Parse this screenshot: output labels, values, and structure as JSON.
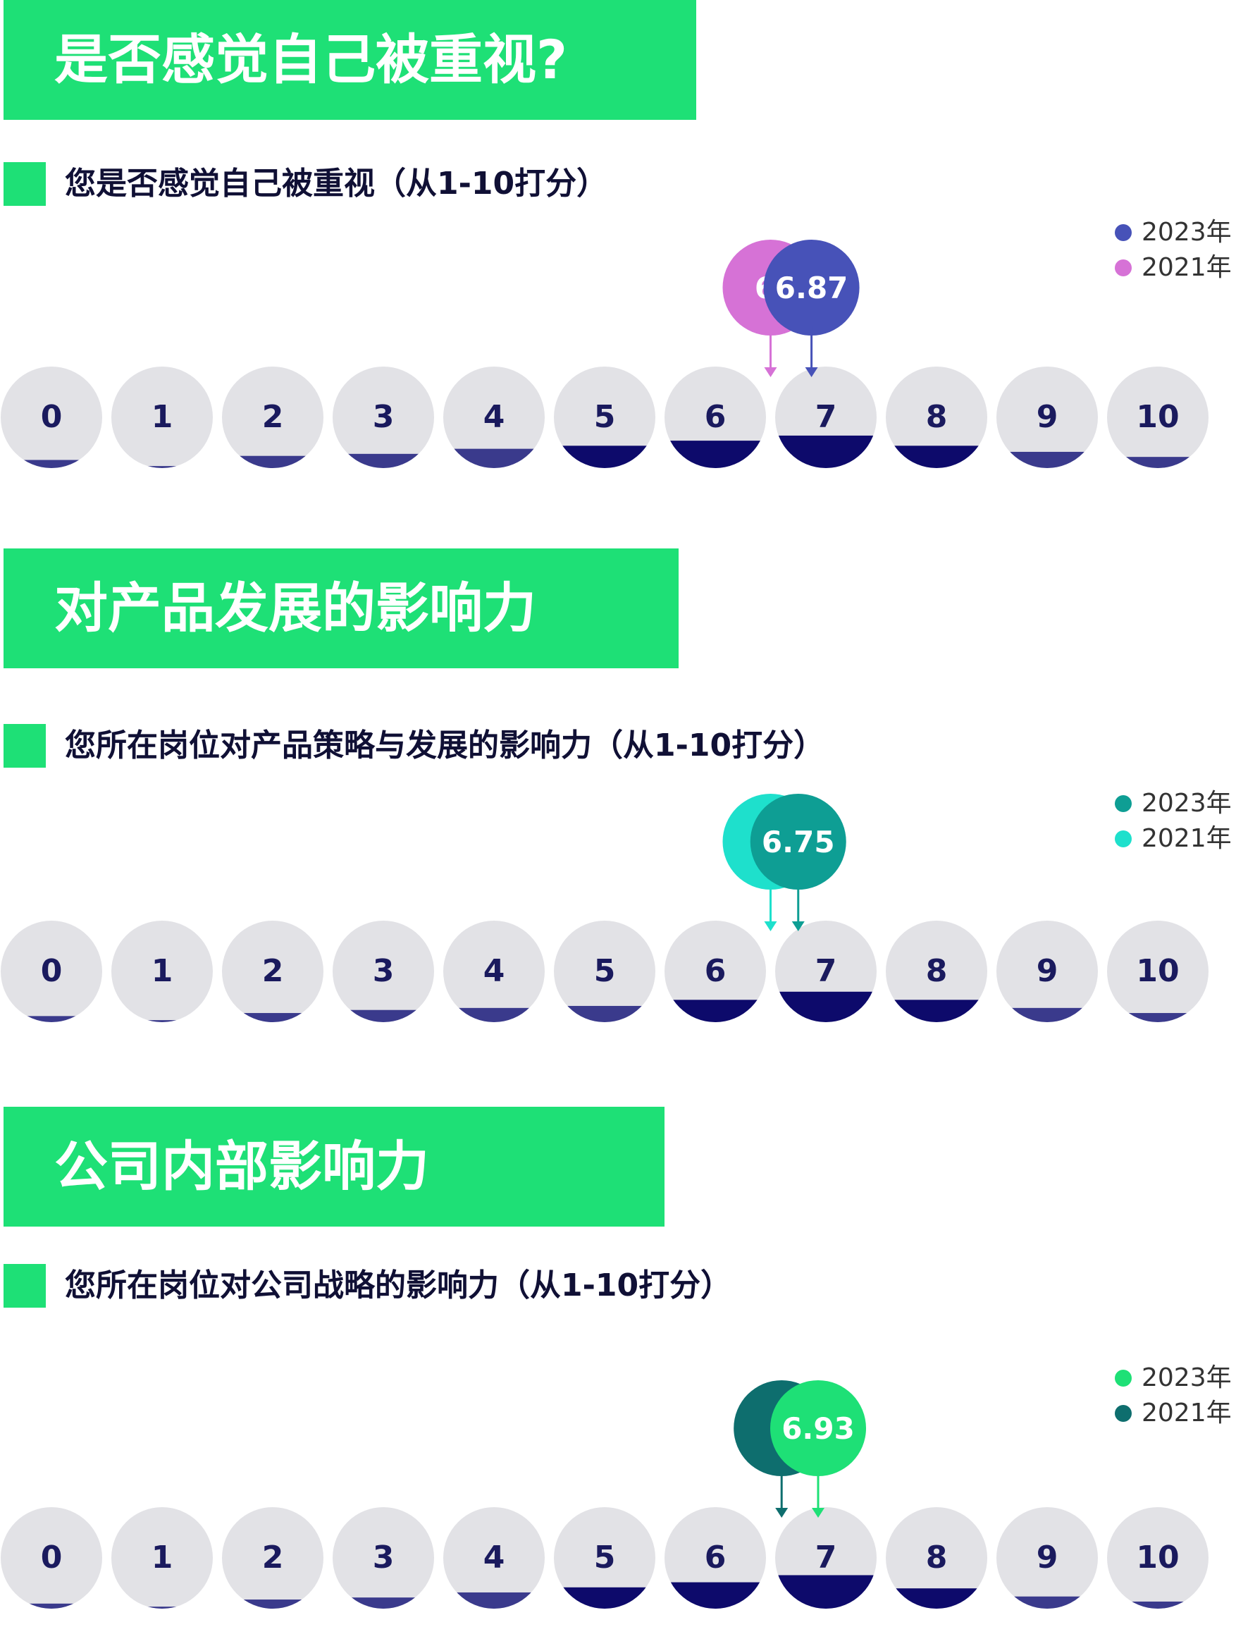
{
  "sections": [
    {
      "title": "是否感觉自己被重视?",
      "question": "您是否感觉自己被重视（从1-10打分）",
      "legend": [
        {
          "label": "2023年",
          "color": "#4752b8"
        },
        {
          "label": "2021年",
          "color": "#d672d6"
        }
      ]
    },
    {
      "title": "对产品发展的影响力",
      "question": "您所在岗位对产品策略与发展的影响力（从1-10打分）",
      "legend": [
        {
          "label": "2023年",
          "color": "#0e9e94"
        },
        {
          "label": "2021年",
          "color": "#1ee0cc"
        }
      ]
    },
    {
      "title": "公司内部影响力",
      "question": "您所在岗位对公司战略的影响力（从1-10打分）",
      "legend": [
        {
          "label": "2023年",
          "color": "#1ee076"
        },
        {
          "label": "2021年",
          "color": "#0e6e6e"
        }
      ]
    }
  ],
  "chart_data": [
    {
      "type": "scale-distribution",
      "title": "是否感觉自己被重视?",
      "scale": [
        0,
        1,
        2,
        3,
        4,
        5,
        6,
        7,
        8,
        9,
        10
      ],
      "fill_fractions": [
        0.08,
        0.02,
        0.12,
        0.14,
        0.19,
        0.22,
        0.27,
        0.32,
        0.22,
        0.16,
        0.11
      ],
      "series": [
        {
          "name": "2023年",
          "mean": 6.87,
          "label": "6.87",
          "color": "#4752b8"
        },
        {
          "name": "2021年",
          "mean": 6.5,
          "label": "6.",
          "color": "#d672d6"
        }
      ]
    },
    {
      "type": "scale-distribution",
      "title": "对产品发展的影响力",
      "scale": [
        0,
        1,
        2,
        3,
        4,
        5,
        6,
        7,
        8,
        9,
        10
      ],
      "fill_fractions": [
        0.06,
        0.02,
        0.09,
        0.12,
        0.14,
        0.16,
        0.22,
        0.3,
        0.22,
        0.14,
        0.09
      ],
      "series": [
        {
          "name": "2023年",
          "mean": 6.75,
          "label": "6.75",
          "color": "#0e9e94"
        },
        {
          "name": "2021年",
          "mean": 6.5,
          "label": "6",
          "color": "#1ee0cc"
        }
      ]
    },
    {
      "type": "scale-distribution",
      "title": "公司内部影响力",
      "scale": [
        0,
        1,
        2,
        3,
        4,
        5,
        6,
        7,
        8,
        9,
        10
      ],
      "fill_fractions": [
        0.05,
        0.02,
        0.09,
        0.11,
        0.16,
        0.21,
        0.26,
        0.33,
        0.2,
        0.12,
        0.07
      ],
      "series": [
        {
          "name": "2023年",
          "mean": 6.93,
          "label": "6.93",
          "color": "#1ee076"
        },
        {
          "name": "2021年",
          "mean": 6.6,
          "label": "(",
          "color": "#0e6e6e"
        }
      ]
    }
  ]
}
